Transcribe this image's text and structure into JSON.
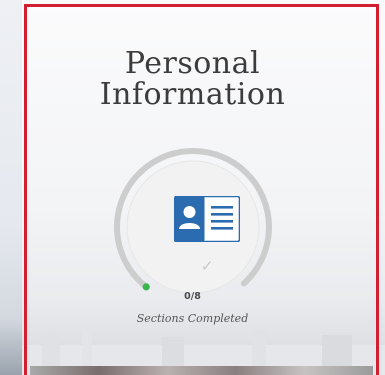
{
  "section": {
    "title_line1": "Personal",
    "title_line2": "Information",
    "completed_count": "0/8",
    "completed_label": "Sections Completed",
    "progress_fraction": 0
  },
  "icons": {
    "main": "id-card-icon",
    "status": "checkmark-icon"
  },
  "colors": {
    "frame_border": "#d11f2f",
    "icon_blue": "#2b6cb0",
    "progress_dot": "#3ab54a",
    "ring_gray": "#cfcfcf"
  }
}
